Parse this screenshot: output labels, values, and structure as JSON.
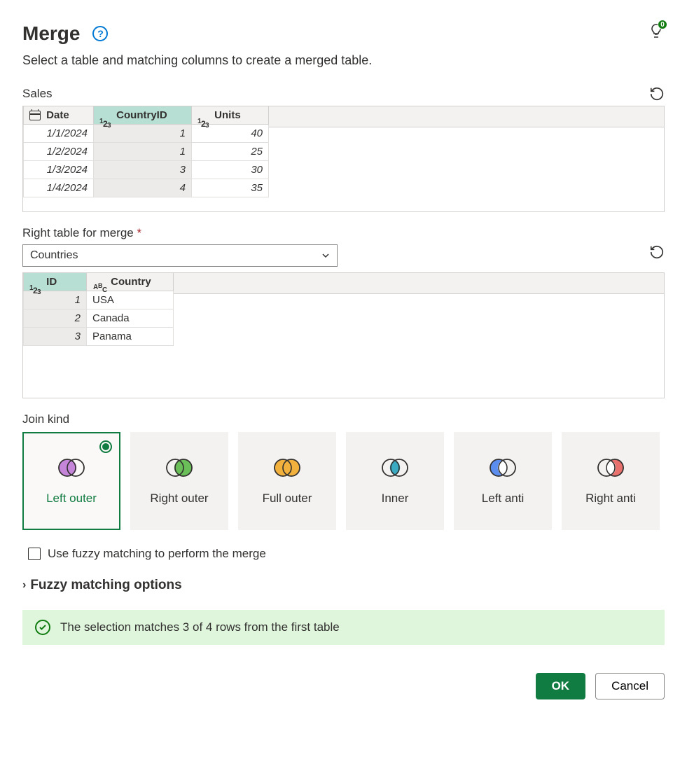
{
  "header": {
    "title": "Merge",
    "subtitle": "Select a table and matching columns to create a merged table.",
    "tips_badge": "0"
  },
  "left_table": {
    "name": "Sales",
    "columns": [
      {
        "label": "Date",
        "type": "date",
        "selected": false
      },
      {
        "label": "CountryID",
        "type": "number",
        "selected": true
      },
      {
        "label": "Units",
        "type": "number",
        "selected": false
      }
    ],
    "rows": [
      {
        "Date": "1/1/2024",
        "CountryID": "1",
        "Units": "40"
      },
      {
        "Date": "1/2/2024",
        "CountryID": "1",
        "Units": "25"
      },
      {
        "Date": "1/3/2024",
        "CountryID": "3",
        "Units": "30"
      },
      {
        "Date": "1/4/2024",
        "CountryID": "4",
        "Units": "35"
      }
    ]
  },
  "right_table_label": "Right table for merge",
  "right_table_dropdown": "Countries",
  "right_table": {
    "columns": [
      {
        "label": "ID",
        "type": "number",
        "selected": true
      },
      {
        "label": "Country",
        "type": "text",
        "selected": false
      }
    ],
    "rows": [
      {
        "ID": "1",
        "Country": "USA"
      },
      {
        "ID": "2",
        "Country": "Canada"
      },
      {
        "ID": "3",
        "Country": "Panama"
      }
    ]
  },
  "join_kind_label": "Join kind",
  "join_kinds": [
    {
      "key": "left-outer",
      "label": "Left outer",
      "selected": true
    },
    {
      "key": "right-outer",
      "label": "Right outer",
      "selected": false
    },
    {
      "key": "full-outer",
      "label": "Full outer",
      "selected": false
    },
    {
      "key": "inner",
      "label": "Inner",
      "selected": false
    },
    {
      "key": "left-anti",
      "label": "Left anti",
      "selected": false
    },
    {
      "key": "right-anti",
      "label": "Right anti",
      "selected": false
    }
  ],
  "fuzzy_checkbox_label": "Use fuzzy matching to perform the merge",
  "fuzzy_options_label": "Fuzzy matching options",
  "status_message": "The selection matches 3 of 4 rows from the first table",
  "footer": {
    "ok": "OK",
    "cancel": "Cancel"
  }
}
